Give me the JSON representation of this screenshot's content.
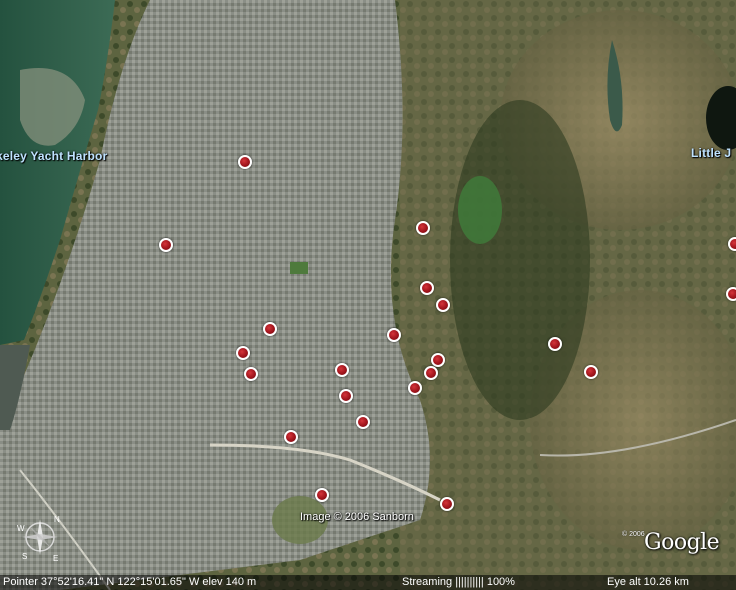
{
  "map": {
    "labels": {
      "yacht_harbor": "keley Yacht Harbor",
      "little": "Little J"
    },
    "pins_count_visible": 23,
    "colors": {
      "pin_fill": "#a0141c",
      "pin_border": "#ffffff",
      "label_text": "#bfe2ff"
    }
  },
  "overlay": {
    "imagery_credit": "Image © 2006 Sanborn",
    "logo_year": "© 2006",
    "logo_text": "Google"
  },
  "compass": {
    "icon": "compass-rose-icon",
    "north": "N",
    "east": "E",
    "south": "S",
    "west": "W"
  },
  "status_bar": {
    "pointer": "Pointer  37°52'16.41\" N  122°15'01.65\" W  elev  140 m",
    "streaming": "Streaming |||||||||| 100%",
    "eye_alt": "Eye  alt    10.26 km"
  }
}
